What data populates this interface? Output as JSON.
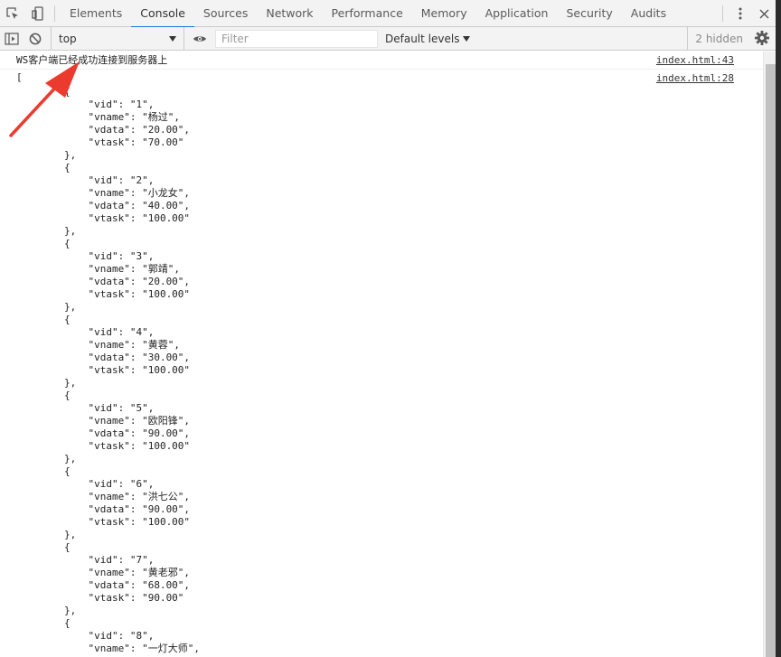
{
  "tabs": [
    {
      "label": "Elements",
      "active": false
    },
    {
      "label": "Console",
      "active": true
    },
    {
      "label": "Sources",
      "active": false
    },
    {
      "label": "Network",
      "active": false
    },
    {
      "label": "Performance",
      "active": false
    },
    {
      "label": "Memory",
      "active": false
    },
    {
      "label": "Application",
      "active": false
    },
    {
      "label": "Security",
      "active": false
    },
    {
      "label": "Audits",
      "active": false
    }
  ],
  "toolbar": {
    "context": "top",
    "filter_placeholder": "Filter",
    "levels": "Default levels",
    "hidden": "2 hidden"
  },
  "console": {
    "message1": {
      "text": "WS客户端已经成功连接到服务器上",
      "source": "index.html:43"
    },
    "message2": {
      "open": "[",
      "source": "index.html:28"
    },
    "records": [
      {
        "vid": "1",
        "vname": "杨过",
        "vdata": "20.00",
        "vtask": "70.00"
      },
      {
        "vid": "2",
        "vname": "小龙女",
        "vdata": "40.00",
        "vtask": "100.00"
      },
      {
        "vid": "3",
        "vname": "郭靖",
        "vdata": "20.00",
        "vtask": "100.00"
      },
      {
        "vid": "4",
        "vname": "黄蓉",
        "vdata": "30.00",
        "vtask": "100.00"
      },
      {
        "vid": "5",
        "vname": "欧阳锋",
        "vdata": "90.00",
        "vtask": "100.00"
      },
      {
        "vid": "6",
        "vname": "洪七公",
        "vdata": "90.00",
        "vtask": "100.00"
      },
      {
        "vid": "7",
        "vname": "黄老邪",
        "vdata": "68.00",
        "vtask": "90.00"
      },
      {
        "vid": "8",
        "vname": "一灯大师"
      }
    ]
  },
  "colors": {
    "accent": "#1a73e8",
    "annotation_arrow": "#ea3b2e"
  },
  "icons": [
    "inspect-icon",
    "device-toolbar-icon",
    "more-vert-icon",
    "close-icon",
    "sidebar-toggle-icon",
    "clear-console-icon",
    "eye-icon",
    "gear-icon"
  ]
}
